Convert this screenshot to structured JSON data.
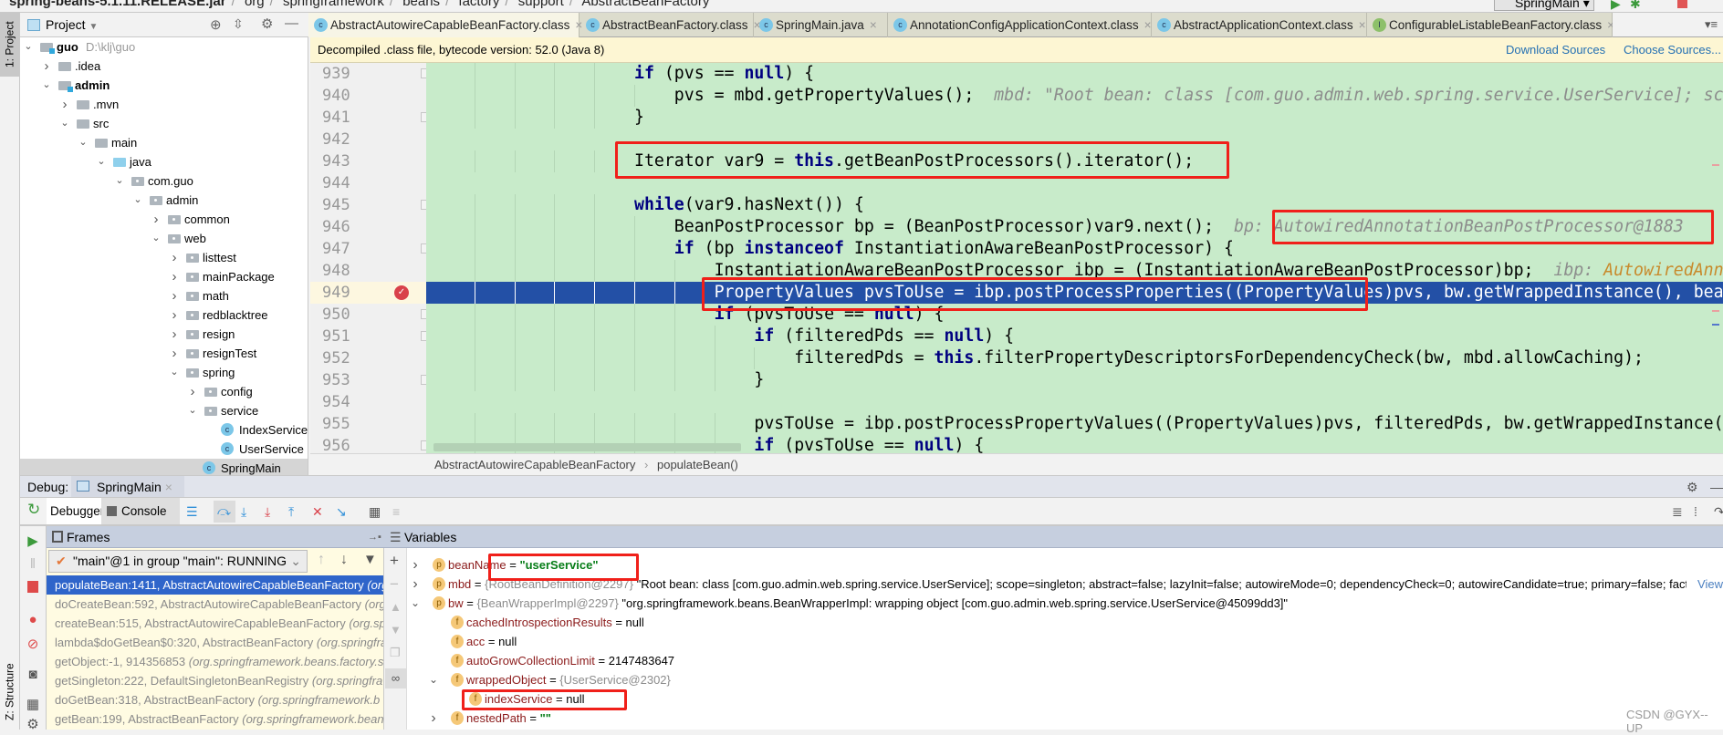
{
  "topbar": {
    "breadcrumbs": [
      "spring-beans-5.1.11.RELEASE.jar",
      "org",
      "springframework",
      "beans",
      "factory",
      "support",
      "AbstractBeanFactory"
    ],
    "run_config": "SpringMain"
  },
  "left_strip": {
    "project_tab": "1: Project",
    "structure_tab": "Z: Structure"
  },
  "project": {
    "title": "Project",
    "tree": [
      {
        "label": "guo",
        "level": 0,
        "icon": "module",
        "expanded": true,
        "bold": true,
        "hint": "D:\\klj\\guo"
      },
      {
        "label": ".idea",
        "level": 1,
        "icon": "folder",
        "expanded": false
      },
      {
        "label": "admin",
        "level": 1,
        "icon": "module",
        "expanded": true,
        "bold": true
      },
      {
        "label": ".mvn",
        "level": 2,
        "icon": "folder",
        "expanded": false
      },
      {
        "label": "src",
        "level": 2,
        "icon": "folder",
        "expanded": true
      },
      {
        "label": "main",
        "level": 3,
        "icon": "folder",
        "expanded": true
      },
      {
        "label": "java",
        "level": 4,
        "icon": "source",
        "expanded": true
      },
      {
        "label": "com.guo",
        "level": 5,
        "icon": "package",
        "expanded": true
      },
      {
        "label": "admin",
        "level": 6,
        "icon": "package",
        "expanded": true
      },
      {
        "label": "common",
        "level": 7,
        "icon": "package",
        "expanded": false
      },
      {
        "label": "web",
        "level": 7,
        "icon": "package",
        "expanded": true
      },
      {
        "label": "listtest",
        "level": 8,
        "icon": "package",
        "expanded": false
      },
      {
        "label": "mainPackage",
        "level": 8,
        "icon": "package",
        "expanded": false
      },
      {
        "label": "math",
        "level": 8,
        "icon": "package",
        "expanded": false
      },
      {
        "label": "redblacktree",
        "level": 8,
        "icon": "package",
        "expanded": false
      },
      {
        "label": "resign",
        "level": 8,
        "icon": "package",
        "expanded": false
      },
      {
        "label": "resignTest",
        "level": 8,
        "icon": "package",
        "expanded": false
      },
      {
        "label": "spring",
        "level": 8,
        "icon": "package",
        "expanded": true
      },
      {
        "label": "config",
        "level": 9,
        "icon": "package",
        "expanded": false
      },
      {
        "label": "service",
        "level": 9,
        "icon": "package",
        "expanded": true
      },
      {
        "label": "IndexService",
        "level": 10,
        "icon": "class"
      },
      {
        "label": "UserService",
        "level": 10,
        "icon": "class"
      },
      {
        "label": "SpringMain",
        "level": 9,
        "icon": "class-main",
        "selected": true
      }
    ]
  },
  "editor": {
    "tabs": [
      {
        "label": "AbstractAutowireCapableBeanFactory.class",
        "kind": "class",
        "active": true
      },
      {
        "label": "AbstractBeanFactory.class",
        "kind": "class"
      },
      {
        "label": "SpringMain.java",
        "kind": "class-main"
      },
      {
        "label": "AnnotationConfigApplicationContext.class",
        "kind": "class"
      },
      {
        "label": "AbstractApplicationContext.class",
        "kind": "class"
      },
      {
        "label": "ConfigurableListableBeanFactory.class",
        "kind": "interface"
      }
    ],
    "banner": {
      "message": "Decompiled .class file, bytecode version: 52.0 (Java 8)",
      "download_sources": "Download Sources",
      "choose_sources": "Choose Sources..."
    },
    "current_line": 949,
    "breakpoint_line": 949,
    "lines": [
      {
        "n": 939,
        "indent": 20,
        "tokens": [
          [
            "if",
            "kw"
          ],
          [
            " (pvs == ",
            ""
          ],
          [
            "null",
            "kw"
          ],
          [
            ") {",
            ""
          ]
        ]
      },
      {
        "n": 940,
        "indent": 24,
        "tokens": [
          [
            "pvs = mbd.getPropertyValues();",
            ""
          ],
          [
            "  mbd: \"Root bean: class [com.guo.admin.web.spring.service.UserService]; sc",
            "hint"
          ]
        ]
      },
      {
        "n": 941,
        "indent": 20,
        "tokens": [
          [
            "}",
            ""
          ]
        ]
      },
      {
        "n": 942,
        "indent": 0,
        "tokens": []
      },
      {
        "n": 943,
        "indent": 20,
        "tokens": [
          [
            "Iterator var9 = ",
            ""
          ],
          [
            "this",
            "kw"
          ],
          [
            ".getBeanPostProcessors().iterator();",
            ""
          ]
        ]
      },
      {
        "n": 944,
        "indent": 0,
        "tokens": []
      },
      {
        "n": 945,
        "indent": 20,
        "tokens": [
          [
            "while",
            "kw"
          ],
          [
            "(var9.hasNext()) {",
            ""
          ]
        ]
      },
      {
        "n": 946,
        "indent": 24,
        "tokens": [
          [
            "BeanPostProcessor bp = (BeanPostProcessor)var9.next();",
            ""
          ],
          [
            "  bp: AutowiredAnnotationBeanPostProcessor@1883",
            "hint"
          ]
        ]
      },
      {
        "n": 947,
        "indent": 24,
        "tokens": [
          [
            "if",
            "kw"
          ],
          [
            " (bp ",
            ""
          ],
          [
            "instanceof",
            "kw"
          ],
          [
            " InstantiationAwareBeanPostProcessor) {",
            ""
          ]
        ]
      },
      {
        "n": 948,
        "indent": 28,
        "tokens": [
          [
            "InstantiationAwareBeanPostProcessor ibp = (InstantiationAwareBeanPostProcessor)bp;",
            ""
          ],
          [
            "  ibp: ",
            "hint"
          ],
          [
            "AutowiredAnn",
            "hintv"
          ]
        ]
      },
      {
        "n": 949,
        "indent": 28,
        "tokens": [
          [
            "PropertyValues pvsToUse = ibp.postProcessProperties((PropertyValues)pvs, bw.getWrappedInstance(), bea",
            ""
          ]
        ]
      },
      {
        "n": 950,
        "indent": 28,
        "tokens": [
          [
            "if",
            "kw"
          ],
          [
            " (pvsToUse == ",
            ""
          ],
          [
            "null",
            "kw"
          ],
          [
            ") {",
            ""
          ]
        ]
      },
      {
        "n": 951,
        "indent": 32,
        "tokens": [
          [
            "if",
            "kw"
          ],
          [
            " (filteredPds == ",
            ""
          ],
          [
            "null",
            "kw"
          ],
          [
            ") {",
            ""
          ]
        ]
      },
      {
        "n": 952,
        "indent": 36,
        "tokens": [
          [
            "filteredPds = ",
            ""
          ],
          [
            "this",
            "kw"
          ],
          [
            ".filterPropertyDescriptorsForDependencyCheck(bw, mbd.allowCaching);",
            ""
          ]
        ]
      },
      {
        "n": 953,
        "indent": 32,
        "tokens": [
          [
            "}",
            ""
          ]
        ]
      },
      {
        "n": 954,
        "indent": 0,
        "tokens": []
      },
      {
        "n": 955,
        "indent": 32,
        "tokens": [
          [
            "pvsToUse = ibp.postProcessPropertyValues((PropertyValues)pvs, filteredPds, bw.getWrappedInstance(",
            ""
          ]
        ]
      },
      {
        "n": 956,
        "indent": 32,
        "tokens": [
          [
            "if",
            "kw"
          ],
          [
            " (pvsToUse == ",
            ""
          ],
          [
            "null",
            "kw"
          ],
          [
            ") {",
            ""
          ]
        ]
      }
    ],
    "breadcrumb": {
      "class": "AbstractAutowireCapableBeanFactory",
      "method": "populateBean()"
    }
  },
  "debug": {
    "label": "Debug:",
    "session_tab": "SpringMain",
    "tabs": {
      "debugger": "Debugger",
      "console": "Console"
    },
    "frames_title": "Frames",
    "variables_title": "Variables",
    "thread": "\"main\"@1 in group \"main\": RUNNING",
    "frames": [
      {
        "text": "populateBean:1411, AbstractAutowireCapableBeanFactory ",
        "pkg": "(org",
        "selected": true
      },
      {
        "text": "doCreateBean:592, AbstractAutowireCapableBeanFactory ",
        "pkg": "(org"
      },
      {
        "text": "createBean:515, AbstractAutowireCapableBeanFactory ",
        "pkg": "(org.sp"
      },
      {
        "text": "lambda$doGetBean$0:320, AbstractBeanFactory ",
        "pkg": "(org.springfra"
      },
      {
        "text": "getObject:-1, 914356853 ",
        "pkg": "(org.springframework.beans.factory.s"
      },
      {
        "text": "getSingleton:222, DefaultSingletonBeanRegistry ",
        "pkg": "(org.springfra"
      },
      {
        "text": "doGetBean:318, AbstractBeanFactory ",
        "pkg": "(org.springframework.b"
      },
      {
        "text": "getBean:199, AbstractBeanFactory ",
        "pkg": "(org.springframework.bean"
      }
    ],
    "variables": [
      {
        "level": 0,
        "arrow": "right",
        "icon": "p",
        "name": "beanName",
        "type": "",
        "value": "\"userService\"",
        "kind": "string"
      },
      {
        "level": 0,
        "arrow": "right",
        "icon": "p",
        "name": "mbd",
        "type": "{RootBeanDefinition@2297}",
        "value": "\"Root bean: class [com.guo.admin.web.spring.service.UserService]; scope=singleton; abstract=false; lazyInit=false; autowireMode=0; dependencyCheck=0; autowireCandidate=true; primary=false; fact...",
        "kind": "text",
        "link": "View"
      },
      {
        "level": 0,
        "arrow": "down",
        "icon": "p",
        "name": "bw",
        "type": "{BeanWrapperImpl@2297}",
        "value": "\"org.springframework.beans.BeanWrapperImpl: wrapping object [com.guo.admin.web.spring.service.UserService@45099dd3]\"",
        "kind": "text"
      },
      {
        "level": 1,
        "arrow": "",
        "icon": "f",
        "name": "cachedIntrospectionResults",
        "type": "",
        "value": "null",
        "kind": "text"
      },
      {
        "level": 1,
        "arrow": "",
        "icon": "f",
        "name": "acc",
        "type": "",
        "value": "null",
        "kind": "text"
      },
      {
        "level": 1,
        "arrow": "",
        "icon": "f",
        "name": "autoGrowCollectionLimit",
        "type": "",
        "value": "2147483647",
        "kind": "text"
      },
      {
        "level": 1,
        "arrow": "down",
        "icon": "f",
        "name": "wrappedObject",
        "type": "{UserService@2302}",
        "value": "",
        "kind": "text"
      },
      {
        "level": 2,
        "arrow": "",
        "icon": "f",
        "name": "indexService",
        "type": "",
        "value": "null",
        "kind": "text"
      },
      {
        "level": 1,
        "arrow": "right",
        "icon": "f",
        "name": "nestedPath",
        "type": "",
        "value": "\"\"",
        "kind": "string"
      }
    ]
  },
  "watermark": "CSDN @GYX--UP",
  "colors": {
    "code_bg": "#c8ebca",
    "current_line": "#2350a6",
    "annotation_red": "#f0201a",
    "selected_frame": "#2f65ca",
    "keyword": "#000080"
  }
}
